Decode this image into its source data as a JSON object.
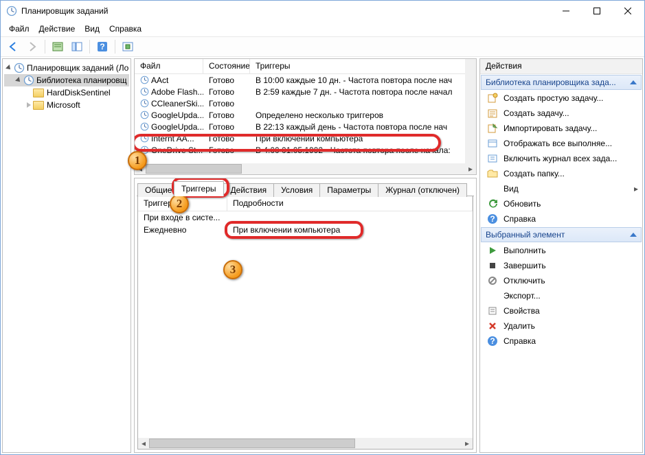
{
  "window": {
    "title": "Планировщик заданий"
  },
  "menu": {
    "file": "Файл",
    "action": "Действие",
    "view": "Вид",
    "help": "Справка"
  },
  "tree": {
    "root": "Планировщик заданий (Ло",
    "lib": "Библиотека планировщ",
    "items": [
      "HardDiskSentinel",
      "Microsoft"
    ]
  },
  "task_table": {
    "headers": [
      "Файл",
      "Состояние",
      "Триггеры"
    ],
    "rows": [
      {
        "name": "AAct",
        "state": "Готово",
        "trigger": "В 10:00 каждые 10 дн. - Частота повтора после нач"
      },
      {
        "name": "Adobe Flash...",
        "state": "Готово",
        "trigger": "В 2:59 каждые 7 дн. - Частота повтора после начал"
      },
      {
        "name": "CCleanerSki...",
        "state": "Готово",
        "trigger": ""
      },
      {
        "name": "GoogleUpda...",
        "state": "Готово",
        "trigger": "Определено несколько триггеров"
      },
      {
        "name": "GoogleUpda...",
        "state": "Готово",
        "trigger": "В 22:13 каждый день - Частота повтора после нач"
      },
      {
        "name": "Internt AA...",
        "state": "Готово",
        "trigger": "При включении компьютера"
      },
      {
        "name": "OneDrive St...",
        "state": "Готово",
        "trigger": "В 4:00 01.05.1992 - Частота повтора после начала:"
      }
    ]
  },
  "detail_tabs": {
    "general": "Общие",
    "triggers": "Триггеры",
    "actions": "Действия",
    "conditions": "Условия",
    "settings": "Параметры",
    "history": "Журнал (отключен)"
  },
  "detail": {
    "headers": [
      "Триггер",
      "Подробности"
    ],
    "rows": [
      {
        "t": "При входе в систе...",
        "d": ""
      },
      {
        "t": "Ежедневно",
        "d": "При включении компьютера"
      }
    ]
  },
  "actions": {
    "title": "Действия",
    "section1": "Библиотека планировщика зада...",
    "items1": [
      "Создать простую задачу...",
      "Создать задачу...",
      "Импортировать задачу...",
      "Отображать все выполняе...",
      "Включить журнал всех зада...",
      "Создать папку...",
      "Вид",
      "Обновить",
      "Справка"
    ],
    "section2": "Выбранный элемент",
    "items2": [
      "Выполнить",
      "Завершить",
      "Отключить",
      "Экспорт...",
      "Свойства",
      "Удалить",
      "Справка"
    ]
  }
}
